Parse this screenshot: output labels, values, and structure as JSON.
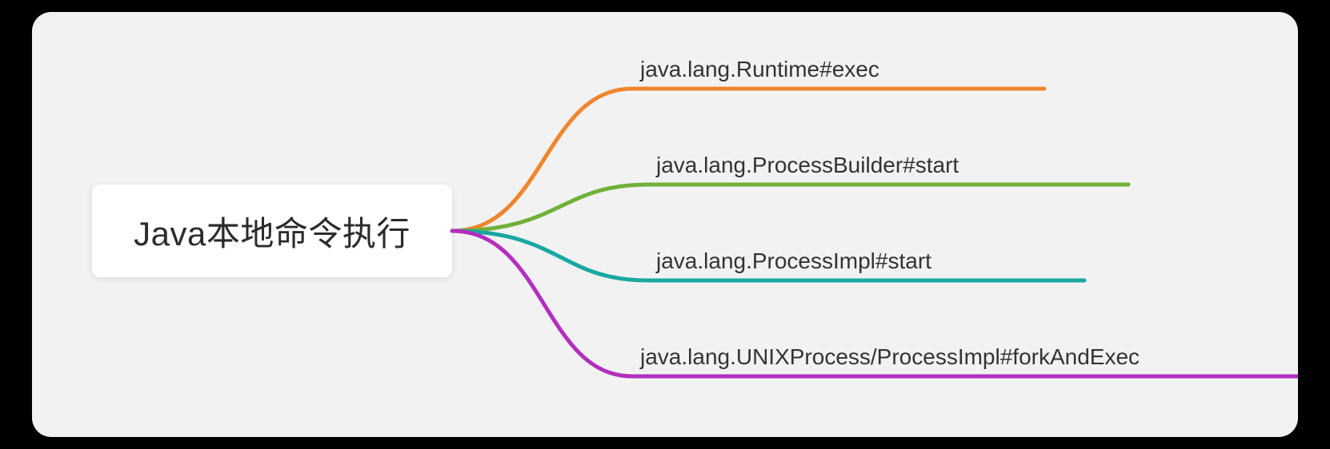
{
  "diagram": {
    "root": {
      "label": "Java本地命令执行"
    },
    "branches": [
      {
        "label": "java.lang.Runtime#exec",
        "color": "#f0852d"
      },
      {
        "label": "java.lang.ProcessBuilder#start",
        "color": "#6fb138"
      },
      {
        "label": "java.lang.ProcessImpl#start",
        "color": "#1aa8a1"
      },
      {
        "label": "java.lang.UNIXProcess/ProcessImpl#forkAndExec",
        "color": "#b22fbd"
      }
    ]
  }
}
